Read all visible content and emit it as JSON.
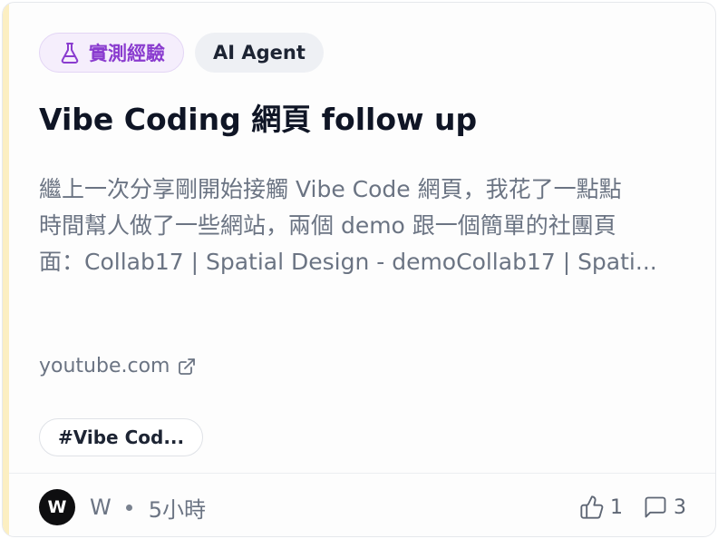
{
  "badges": {
    "category_label": "實測經驗",
    "category_icon": "flask-icon",
    "topic_label": "AI Agent"
  },
  "post": {
    "title": "Vibe Coding 網頁 follow up",
    "description_lines": [
      "繼上一次分享剛開始接觸 Vibe Code 網頁，我花了一點點",
      "時間幫人做了一些網站，兩個 demo 跟一個簡單的社團頁",
      "面：Collab17 | Spatial Design - demoCollab17 | Spati..."
    ],
    "source": "youtube.com",
    "source_icon": "external-link-icon",
    "tags": [
      "#Vibe Cod..."
    ]
  },
  "footer": {
    "avatar_letter": "W",
    "author": "W",
    "time": "5小時",
    "likes": "1",
    "likes_icon": "thumbs-up-icon",
    "comments": "3",
    "comments_icon": "comment-icon"
  },
  "colors": {
    "category_accent": "#8a3ccf",
    "left_accent": "#fcefc2",
    "muted_text": "#6b7483"
  }
}
